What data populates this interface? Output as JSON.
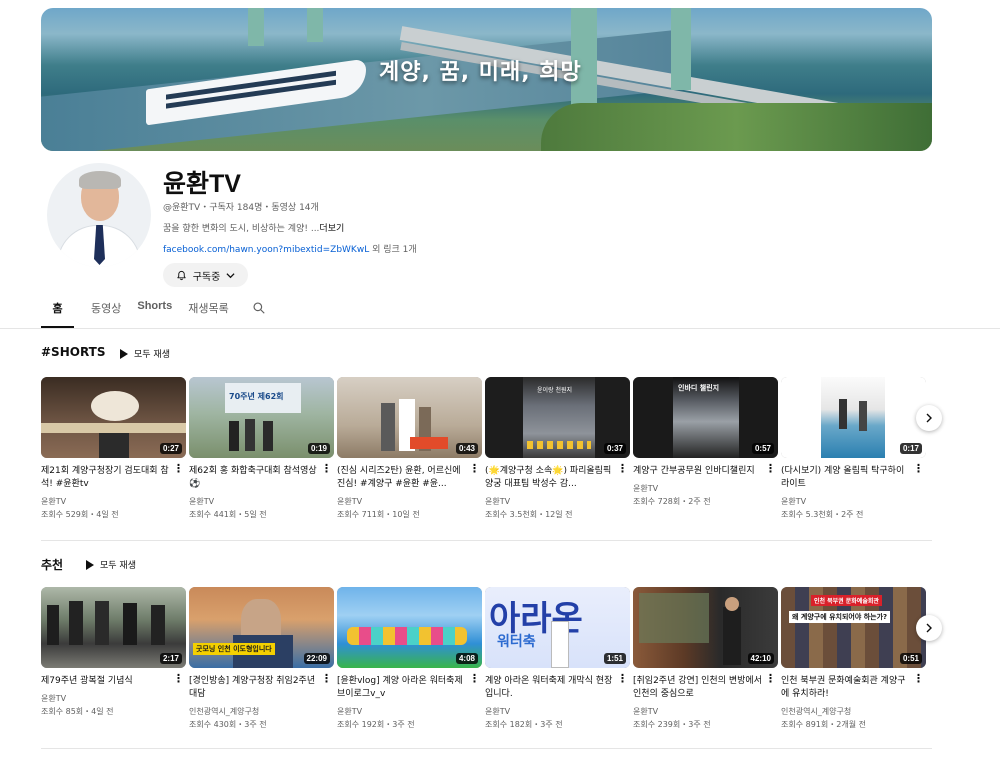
{
  "banner": {
    "slogan": "계양, 꿈, 미래, 희망"
  },
  "channel": {
    "name": "윤환TV",
    "meta": "@윤환TV・구독자 184명・동영상 14개",
    "description": "꿈을 향한 변화의 도시, 비상하는 계양! ...",
    "more_label": "더보기",
    "link": "facebook.com/hawn.yoon?mibextid=ZbWKwL",
    "link_extra": "외 링크 1개",
    "subscribe_label": "구독중"
  },
  "tabs": [
    {
      "label": "홈"
    },
    {
      "label": "동영상"
    },
    {
      "label": "Shorts"
    },
    {
      "label": "재생목록"
    }
  ],
  "shorts": {
    "title": "#SHORTS",
    "play_all": "모두 재생",
    "items": [
      {
        "title": "제21회 계양구청장기 검도대회 참석! #윤환tv",
        "author": "윤환TV",
        "stats": "조회수 529회・4일 전",
        "duration": "0:27"
      },
      {
        "title": "제62회 홍 화합축구대회 참석영상⚽",
        "author": "윤환TV",
        "stats": "조회수 441회・5일 전",
        "duration": "0:19"
      },
      {
        "title": "(진심 시리즈2탄) 윤환, 어르신에 진심! #계양구 #윤환 #윤...",
        "author": "윤환TV",
        "stats": "조회수 711회・10일 전",
        "duration": "0:43"
      },
      {
        "title": "(🌟계양구청 소속🌟) 파리올림픽 양궁 대표팀 박성수 감...",
        "author": "윤환TV",
        "stats": "조회수 3.5천회・12일 전",
        "duration": "0:37"
      },
      {
        "title": "계양구 간부공무원 인바디챌린지",
        "author": "윤환TV",
        "stats": "조회수 728회・2주 전",
        "duration": "0:57"
      },
      {
        "title": "(다시보기) 계양 올림픽 탁구하이라이트",
        "author": "윤환TV",
        "stats": "조회수 5.3천회・2주 전",
        "duration": "0:17"
      }
    ]
  },
  "recommended": {
    "title": "추천",
    "play_all": "모두 재생",
    "items": [
      {
        "title": "제79주년 광복절 기념식",
        "author": "윤환TV",
        "stats": "조회수 85회・4일 전",
        "duration": "2:17"
      },
      {
        "title": "[경인방송] 계양구청장 취임2주년 대담",
        "author": "인천광역시_계양구청",
        "stats": "조회수 430회・3주 전",
        "duration": "22:09"
      },
      {
        "title": "[윤환vlog] 계양 아라온 워터축제 브이로그v_v",
        "author": "윤환TV",
        "stats": "조회수 192회・3주 전",
        "duration": "4:08"
      },
      {
        "title": "계양 아라온 워터축제 개막식 현장입니다.",
        "author": "윤환TV",
        "stats": "조회수 182회・3주 전",
        "duration": "1:51"
      },
      {
        "title": "[취임2주년 강연] 인천의 변방에서 인천의 중심으로",
        "author": "윤환TV",
        "stats": "조회수 239회・3주 전",
        "duration": "42:10"
      },
      {
        "title": "인천 북부권 문화예술회관 계양구에 유치하라!",
        "author": "인천광역시_계양구청",
        "stats": "조회수 891회・2개월 전",
        "duration": "0:51"
      }
    ]
  },
  "thumb_texts": {
    "s2": "70주년 제62회",
    "s4": "윤이랑 천원지",
    "s5": "인바디 챌린지",
    "r2": "굿모닝 인천 이도형입니다",
    "r4a": "아라온",
    "r4b": "워터축",
    "r6a": "인천 북부권 문화예술회관",
    "r6b": "왜 계양구에 유치되어야 하는가?"
  },
  "colors": {
    "link": "#065fd4",
    "secondary_text": "#606060",
    "primary_text": "#0f0f0f",
    "chip_bg": "#f2f2f2"
  }
}
